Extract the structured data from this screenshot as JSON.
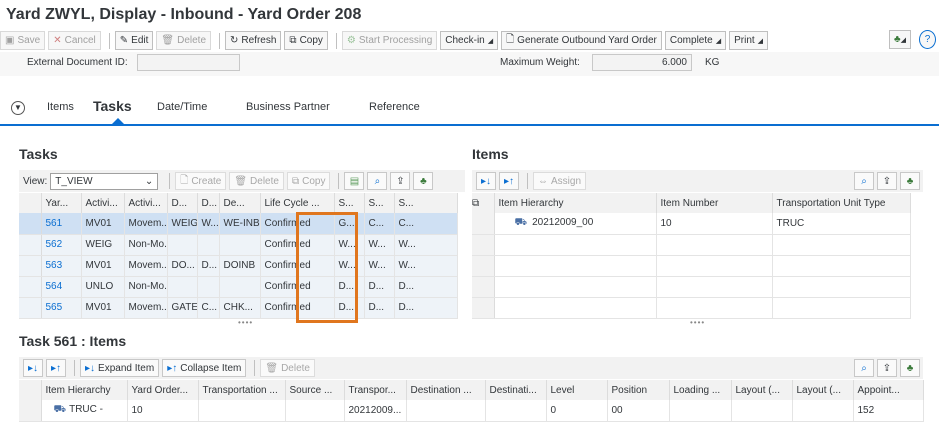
{
  "title": "Yard ZWYL,  Display - Inbound - Yard Order 208",
  "toolbar": {
    "save": "Save",
    "cancel": "Cancel",
    "edit": "Edit",
    "delete": "Delete",
    "refresh": "Refresh",
    "copy": "Copy",
    "start_processing": "Start Processing",
    "checkin": "Check-in",
    "generate_outbound": "Generate Outbound Yard Order",
    "complete": "Complete",
    "print": "Print"
  },
  "header_fields": {
    "external_doc_label": "External Document ID:",
    "external_doc_value": "",
    "max_weight_label": "Maximum Weight:",
    "max_weight_value": "6.000",
    "max_weight_unit": "KG"
  },
  "tabs": [
    "Items",
    "Tasks",
    "Date/Time",
    "Business Partner",
    "Reference"
  ],
  "tasks": {
    "title": "Tasks",
    "view_label": "View:",
    "view_value": "T_VIEW",
    "create": "Create",
    "delete": "Delete",
    "copy": "Copy",
    "columns": [
      "Yar...",
      "Activi...",
      "Activi...",
      "D...",
      "D...",
      "De...",
      "Life Cycle ...",
      "S...",
      "S...",
      "S..."
    ],
    "rows": [
      [
        "561",
        "MV01",
        "Movem...",
        "WEIG",
        "W...",
        "WE-INB",
        "Confirmed",
        "G...",
        "C...",
        "C..."
      ],
      [
        "562",
        "WEIG",
        "Non-Mo...",
        "",
        "",
        "",
        "Confirmed",
        "W...",
        "W...",
        "W..."
      ],
      [
        "563",
        "MV01",
        "Movem...",
        "DO...",
        "D...",
        "DOINB",
        "Confirmed",
        "W...",
        "W...",
        "W..."
      ],
      [
        "564",
        "UNLO",
        "Non-Mo...",
        "",
        "",
        "",
        "Confirmed",
        "D...",
        "D...",
        "D..."
      ],
      [
        "565",
        "MV01",
        "Movem...",
        "GATE",
        "C...",
        "CHK...",
        "Confirmed",
        "D...",
        "D...",
        "D..."
      ]
    ]
  },
  "items": {
    "title": "Items",
    "assign": "Assign",
    "columns": [
      "Item Hierarchy",
      "Item Number",
      "Transportation Unit Type"
    ],
    "rows": [
      [
        "20212009_00",
        "10",
        "TRUC"
      ]
    ]
  },
  "task_items": {
    "title": "Task 561 : Items",
    "expand": "Expand Item",
    "collapse": "Collapse Item",
    "delete": "Delete",
    "columns": [
      "Item Hierarchy",
      "Yard Order...",
      "Transportation ...",
      "Source ...",
      "Transpor...",
      "Destination ...",
      "Destinati...",
      "Level",
      "Position",
      "Loading ...",
      "Layout (...",
      "Layout (...",
      "Appoint..."
    ],
    "rows": [
      [
        "TRUC -",
        "10",
        "",
        "",
        "20212009...",
        "",
        "",
        "0",
        "00",
        "",
        "",
        "",
        "152"
      ]
    ]
  },
  "colors": {
    "accent": "#0a6ed1",
    "highlight": "#e0761e"
  }
}
